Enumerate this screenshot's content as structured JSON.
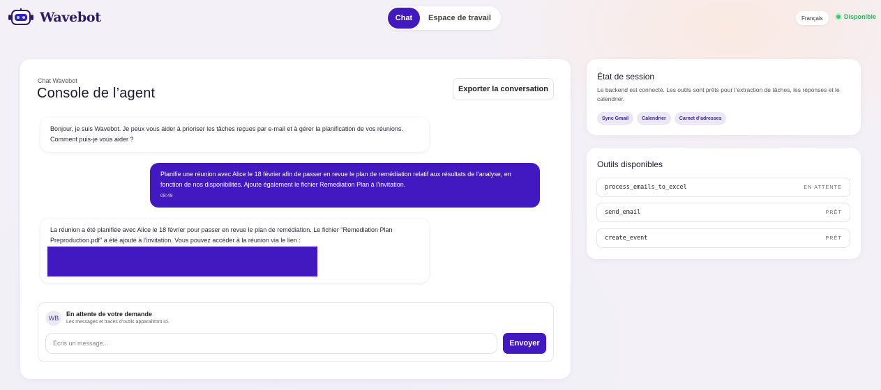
{
  "header": {
    "brand": "Wavebot",
    "tabs": [
      {
        "label": "Chat",
        "active": true
      },
      {
        "label": "Espace de travail",
        "active": false
      }
    ],
    "language": "Français",
    "status": "Disponible"
  },
  "main": {
    "subtitle": "Chat Wavebot",
    "title": "Console de l’agent",
    "export_label": "Exporter la conversation",
    "messages": [
      {
        "role": "bot",
        "text": "Bonjour, je suis Wavebot. Je peux vous aider à prioriser les tâches reçues par e-mail et à gérer la planification de vos réunions. Comment puis-je vous aider ?"
      },
      {
        "role": "user",
        "text": "Planifie une réunion avec Alice le 18 février afin de passer en revue le plan de remédiation relatif aux résultats de l’analyse, en fonction de nos disponibilités. Ajoute également le fichier Remediation Plan à l’invitation.",
        "time": "08:49"
      },
      {
        "role": "bot",
        "text": "La réunion a été planifiée avec Alice le 18 février pour passer en revue le plan de remédiation. Le fichier \"Remediation Plan Preproduction.pdf\" a été ajouté à l’invitation. Vous pouvez accéder à la réunion via le lien :"
      }
    ],
    "composer": {
      "avatar": "WB",
      "title": "En attente de votre demande",
      "subtitle": "Les messages et traces d’outils apparaîtront ici.",
      "placeholder": "Écris un message...",
      "send_label": "Envoyer"
    }
  },
  "session": {
    "title": "État de session",
    "description": "Le backend est connecté. Les outils sont prêts pour l’extraction de tâches, les réponses et le calendrier.",
    "chips": [
      "Sync Gmail",
      "Calendrier",
      "Carnet d’adresses"
    ]
  },
  "tools": {
    "title": "Outils disponibles",
    "items": [
      {
        "name": "process_emails_to_excel",
        "status": "EN ATTENTE"
      },
      {
        "name": "send_email",
        "status": "PRÊT"
      },
      {
        "name": "create_event",
        "status": "PRÊT"
      }
    ]
  },
  "colors": {
    "accent": "#4219c1",
    "status_green": "#2fb55a"
  }
}
